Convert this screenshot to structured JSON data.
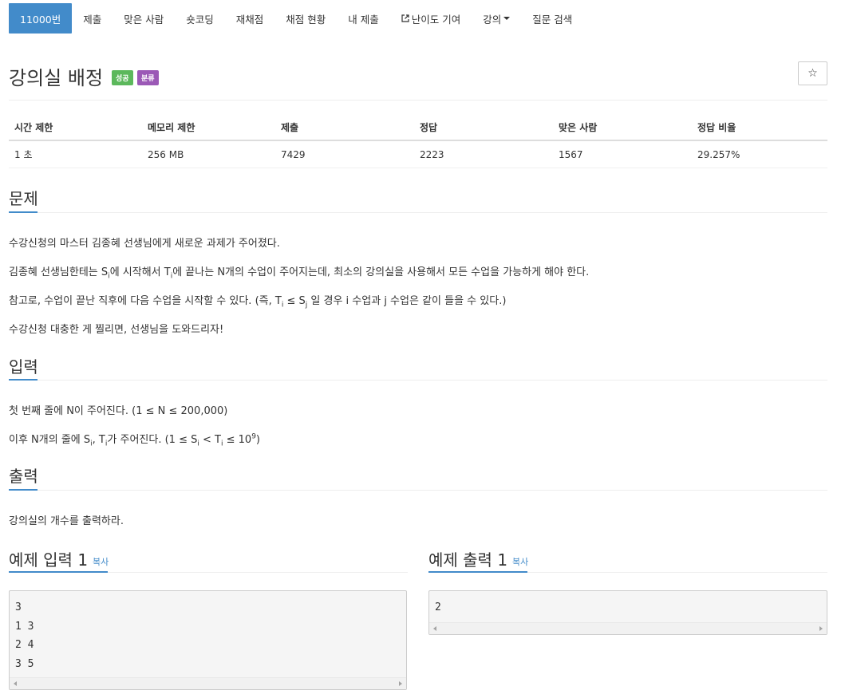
{
  "nav": {
    "items": [
      {
        "label": "11000번",
        "active": true
      },
      {
        "label": "제출"
      },
      {
        "label": "맞은 사람"
      },
      {
        "label": "숏코딩"
      },
      {
        "label": "재채점"
      },
      {
        "label": "채점 현황"
      },
      {
        "label": "내 제출"
      },
      {
        "label": "난이도 기여",
        "icon": "external-link-icon"
      },
      {
        "label": "강의",
        "dropdown": true
      },
      {
        "label": "질문 검색"
      }
    ]
  },
  "problem": {
    "title": "강의실 배정",
    "badges": {
      "success": "성공",
      "category": "분류"
    },
    "star_icon": "☆"
  },
  "info": {
    "headers": [
      "시간 제한",
      "메모리 제한",
      "제출",
      "정답",
      "맞은 사람",
      "정답 비율"
    ],
    "values": [
      "1 초",
      "256 MB",
      "7429",
      "2223",
      "1567",
      "29.257%"
    ]
  },
  "sections": {
    "problem_title": "문제",
    "input_title": "입력",
    "output_title": "출력"
  },
  "description": {
    "line1": "수강신청의 마스터 김종혜 선생님에게 새로운 과제가 주어졌다.",
    "line2_a": "김종혜 선생님한테는 S",
    "line2_sub1": "i",
    "line2_b": "에 시작해서 T",
    "line2_sub2": "i",
    "line2_c": "에 끝나는 N개의 수업이 주어지는데, 최소의 강의실을 사용해서 모든 수업을 가능하게 해야 한다.",
    "line3_a": "참고로, 수업이 끝난 직후에 다음 수업을 시작할 수 있다. (즉, T",
    "line3_sub1": "i",
    "line3_b": " ≤ S",
    "line3_sub2": "j",
    "line3_c": " 일 경우 i 수업과 j 수업은 같이 들을 수 있다.)",
    "line4": "수강신청 대충한 게 찔리면, 선생님을 도와드리자!"
  },
  "input_desc": {
    "line1": "첫 번째 줄에 N이 주어진다. (1 ≤ N ≤ 200,000)",
    "line2_a": "이후 N개의 줄에 S",
    "line2_sub1": "i",
    "line2_b": ", T",
    "line2_sub2": "i",
    "line2_c": "가 주어진다. (1 ≤ S",
    "line2_sub3": "i",
    "line2_d": " < T",
    "line2_sub4": "i",
    "line2_e": " ≤ 10",
    "line2_sup": "9",
    "line2_f": ")"
  },
  "output_desc": {
    "line1": "강의실의 개수를 출력하라."
  },
  "samples": {
    "input_title": "예제 입력 1",
    "output_title": "예제 출력 1",
    "copy_label": "복사",
    "input_text": "3\n1 3\n2 4\n3 5",
    "output_text": "2"
  },
  "colors": {
    "primary": "#428bca",
    "success": "#5cb85c",
    "category": "#9b59b6"
  }
}
